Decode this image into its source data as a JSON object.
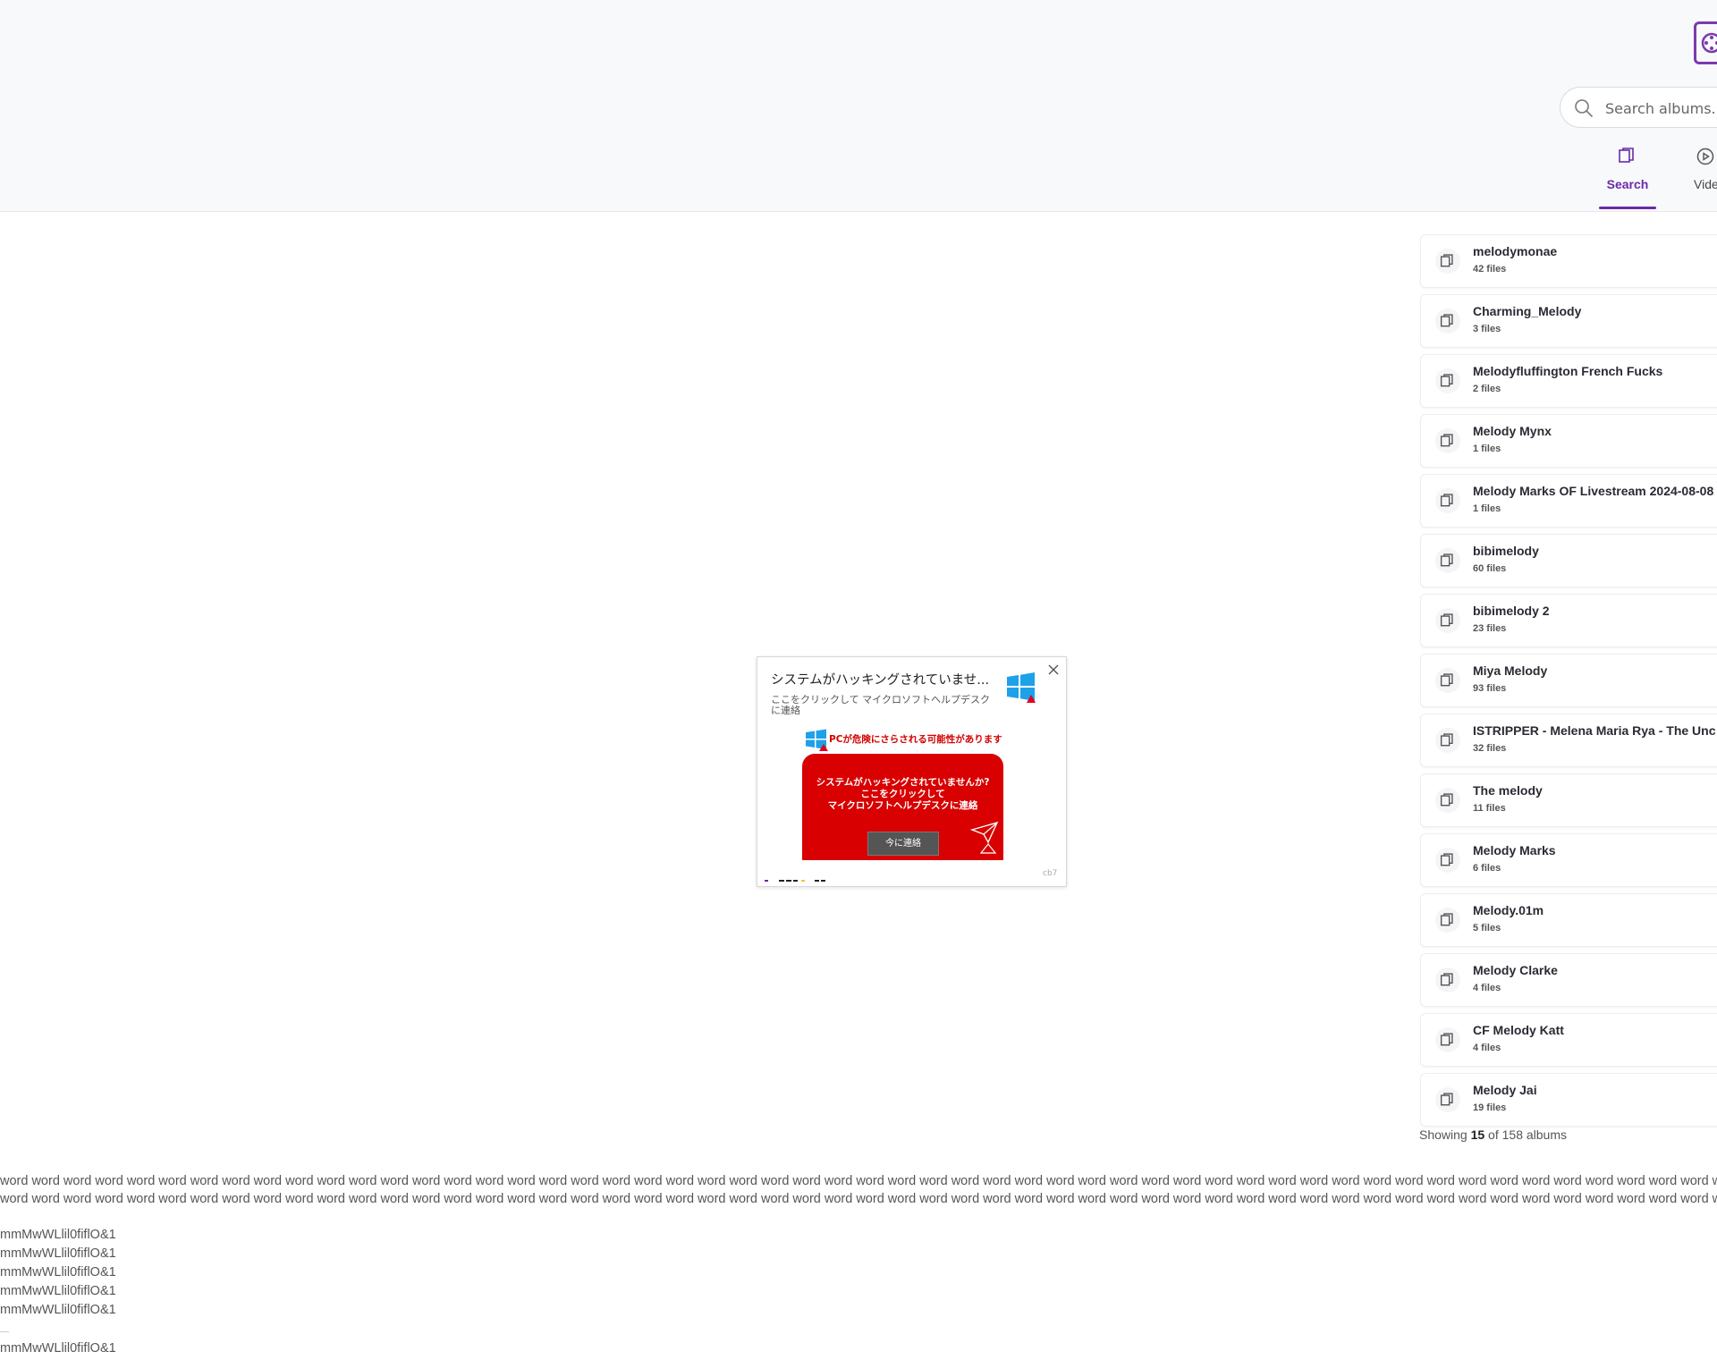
{
  "header": {
    "search": {
      "placeholder": "Search albums...."
    },
    "tabs": [
      {
        "label": "Search",
        "icon": "albums-icon",
        "active": true
      },
      {
        "label": "Video",
        "icon": "play-circle-icon",
        "active": false
      }
    ]
  },
  "albums": [
    {
      "title": "melodymonae",
      "count": "42 files"
    },
    {
      "title": "Charming_Melody",
      "count": "3 files"
    },
    {
      "title": "Melodyfluffington French Fucks",
      "count": "2 files"
    },
    {
      "title": "Melody Mynx",
      "count": "1 files"
    },
    {
      "title": "Melody Marks OF Livestream 2024-08-08",
      "count": "1 files"
    },
    {
      "title": "bibimelody",
      "count": "60 files"
    },
    {
      "title": "bibimelody 2",
      "count": "23 files"
    },
    {
      "title": "Miya Melody",
      "count": "93 files"
    },
    {
      "title": "ISTRIPPER - Melena Maria Rya - The Unc",
      "count": "32 files"
    },
    {
      "title": "The melody",
      "count": "11 files"
    },
    {
      "title": "Melody Marks",
      "count": "6 files"
    },
    {
      "title": "Melody.01m",
      "count": "5 files"
    },
    {
      "title": "Melody Clarke",
      "count": "4 files"
    },
    {
      "title": "CF Melody Katt",
      "count": "4 files"
    },
    {
      "title": "Melody Jai",
      "count": "19 files"
    }
  ],
  "showing": {
    "prefix": "Showing ",
    "shown": "15",
    "middle": " of 158 albums"
  },
  "ad": {
    "title": "システムがハッキングされていませ...",
    "subtitle": "ここをクリックして マイクロソフトヘルプデスクに連絡",
    "warning": "PCが危険にさらされる可能性があります",
    "banner_lines": [
      "システムがハッキングされていませんか?",
      "ここをクリックして",
      "マイクロソフトヘルプデスクに連絡"
    ],
    "button": "今に連絡",
    "id": "cb7"
  },
  "footer": {
    "word_line_1": "word word word word word word word word word word word word word word word word word word word word word word word word word word word word word word word word word word word word word word word word word word word word word word word word word word word word word word word word word word word word word word word word word word word",
    "word_line_2": "word word word word word word word word word word word word word word word word word word word word word word word word word word word word word word word word word word word word word word word word word word word word word word word word word word word word word word word word word word word word word word word word word word word",
    "mm_lines": [
      "mmMwWLlil0fiflO&1",
      "mmMwWLlil0fiflO&1",
      "mmMwWLlil0fiflO&1",
      "mmMwWLlil0fiflO&1",
      "mmMwWLlil0fiflO&1"
    ],
    "mm_last": "mmMwWLlil0fiflO&1"
  },
  "colors": {
    "accent": "#6a2aa8",
    "ad_red": "#d80000",
    "header_bg": "#f8f9fb"
  }
}
